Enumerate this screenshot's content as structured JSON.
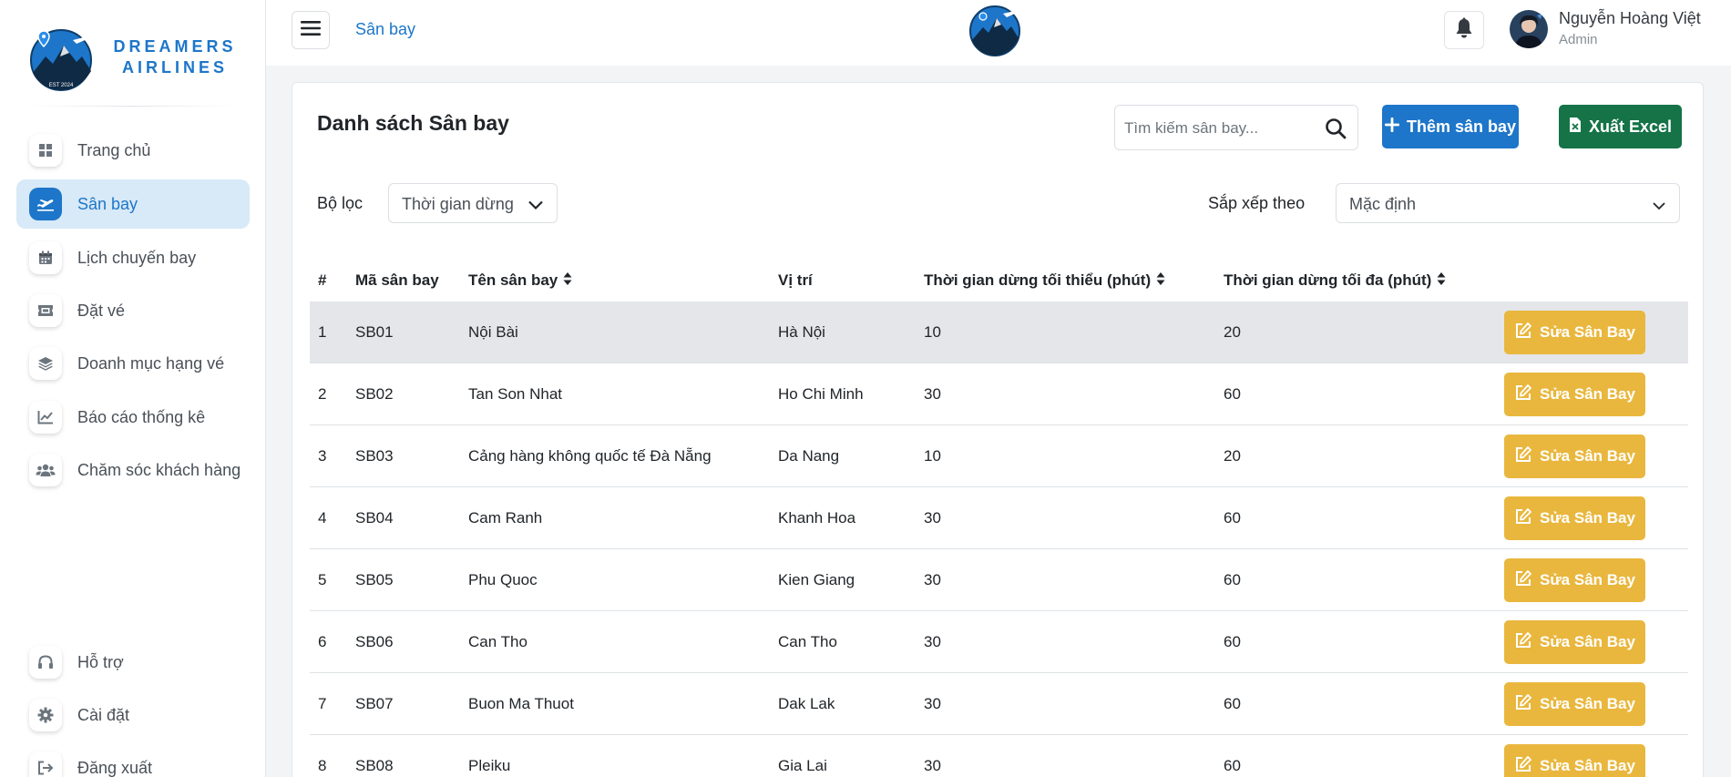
{
  "brand": {
    "line1": "DREAMERS",
    "line2": "AIRLINES"
  },
  "sidebar": {
    "items": [
      {
        "label": "Trang chủ",
        "icon": "windows-icon"
      },
      {
        "label": "Sân bay",
        "icon": "plane-departure-icon",
        "active": true
      },
      {
        "label": "Lịch chuyến bay",
        "icon": "calendar-icon"
      },
      {
        "label": "Đặt vé",
        "icon": "ticket-icon"
      },
      {
        "label": "Doanh mục hạng vé",
        "icon": "layers-icon"
      },
      {
        "label": "Báo cáo thống kê",
        "icon": "line-chart-icon"
      },
      {
        "label": "Chăm sóc khách hàng",
        "icon": "users-icon"
      }
    ],
    "bottom_items": [
      {
        "label": "Hỗ trợ",
        "icon": "headphones-icon"
      },
      {
        "label": "Cài đặt",
        "icon": "gear-icon"
      },
      {
        "label": "Đăng xuất",
        "icon": "logout-icon"
      }
    ]
  },
  "header": {
    "breadcrumb": "Sân bay",
    "user": {
      "name": "Nguyễn Hoàng Việt",
      "role": "Admin"
    }
  },
  "main": {
    "title": "Danh sách Sân bay",
    "search_placeholder": "Tìm kiếm sân bay...",
    "add_button": "Thêm sân bay",
    "excel_button": "Xuất Excel",
    "filter_label": "Bộ lọc",
    "filter_value": "Thời gian dừng",
    "sort_label": "Sắp xếp theo",
    "sort_value": "Mặc định"
  },
  "table": {
    "columns": [
      "#",
      "Mã sân bay",
      "Tên sân bay",
      "Vị trí",
      "Thời gian dừng tối thiểu (phút)",
      "Thời gian dừng tối đa (phút)"
    ],
    "edit_label": "Sửa Sân Bay",
    "rows": [
      [
        "1",
        "SB01",
        "Nội Bài",
        "Hà Nội",
        "10",
        "20"
      ],
      [
        "2",
        "SB02",
        "Tan Son Nhat",
        "Ho Chi Minh",
        "30",
        "60"
      ],
      [
        "3",
        "SB03",
        "Cảng hàng không quốc tế Đà Nẵng",
        "Da Nang",
        "10",
        "20"
      ],
      [
        "4",
        "SB04",
        "Cam Ranh",
        "Khanh Hoa",
        "30",
        "60"
      ],
      [
        "5",
        "SB05",
        "Phu Quoc",
        "Kien Giang",
        "30",
        "60"
      ],
      [
        "6",
        "SB06",
        "Can Tho",
        "Can Tho",
        "30",
        "60"
      ],
      [
        "7",
        "SB07",
        "Buon Ma Thuot",
        "Dak Lak",
        "30",
        "60"
      ],
      [
        "8",
        "SB08",
        "Pleiku",
        "Gia Lai",
        "30",
        "60"
      ]
    ]
  },
  "colors": {
    "primary": "#1d76c9",
    "success": "#157347",
    "warning": "#e9b73e"
  }
}
